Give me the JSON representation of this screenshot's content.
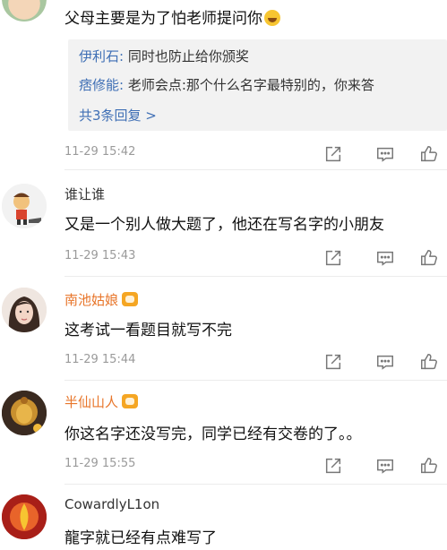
{
  "comments": [
    {
      "text": "父母主要是为了怕老师提问你",
      "time": "11-29 15:42",
      "replies": [
        {
          "name": "伊利石:",
          "text": " 同时也防止给你颁奖"
        },
        {
          "name": "痞修能:",
          "text": " 老师会点:那个什么名字最特别的，你来答"
        }
      ],
      "more": "共3条回复 >"
    },
    {
      "name": "谁让谁",
      "text": "又是一个别人做大题了，他还在写名字的小朋友",
      "time": "11-29 15:43"
    },
    {
      "name": "南池姑娘",
      "text": "这考试一看题目就写不完",
      "time": "11-29 15:44"
    },
    {
      "name": "半仙山人",
      "text": "你这名字还没写完，同学已经有交卷的了。。",
      "time": "11-29 15:55"
    },
    {
      "name": "CowardlyL1on",
      "text": "龍字就已经有点难写了"
    }
  ],
  "colors": {
    "vip_name": "#e8762b",
    "link": "#3f6fb5",
    "meta": "#9a9a9a"
  },
  "icons": [
    "share-icon",
    "comment-icon",
    "like-icon"
  ]
}
